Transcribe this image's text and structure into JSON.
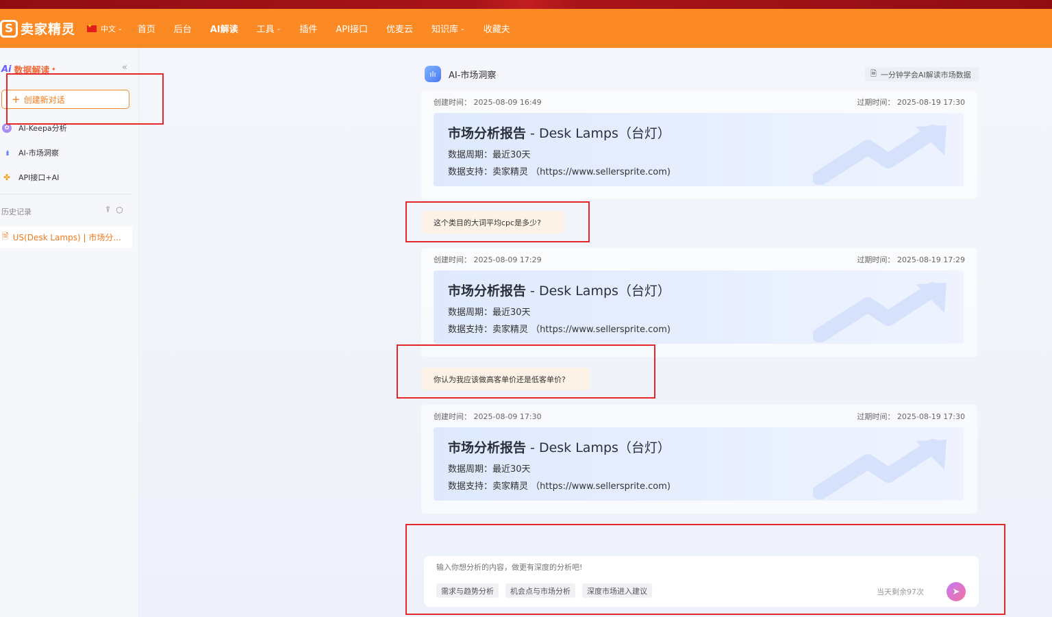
{
  "navbar": {
    "logo_text": "卖家精灵",
    "language": "中文",
    "items": [
      {
        "label": "首页",
        "dropdown": false,
        "bold": false
      },
      {
        "label": "后台",
        "dropdown": false,
        "bold": false
      },
      {
        "label": "AI解读",
        "dropdown": false,
        "bold": true
      },
      {
        "label": "工具",
        "dropdown": true,
        "bold": false
      },
      {
        "label": "插件",
        "dropdown": false,
        "bold": false
      },
      {
        "label": "API接口",
        "dropdown": false,
        "bold": false
      },
      {
        "label": "优麦云",
        "dropdown": false,
        "bold": false
      },
      {
        "label": "知识库",
        "dropdown": true,
        "bold": false
      },
      {
        "label": "收藏夫",
        "dropdown": false,
        "bold": false
      }
    ]
  },
  "sidebar": {
    "title_badge": "Ai",
    "title": "数据解读",
    "new_chat_label": "创建新对话",
    "menu": [
      {
        "label": "AI-Keepa分析",
        "icon": "keepa-icon"
      },
      {
        "label": "AI-市场洞察",
        "icon": "bar-chart-icon"
      },
      {
        "label": "API接口+AI",
        "icon": "api-icon"
      }
    ],
    "history_label": "历史记录",
    "history_items": [
      {
        "label": "US(Desk Lamps) | 市场分..."
      }
    ]
  },
  "chat": {
    "title": "AI-市场洞察",
    "guide_label": "一分钟学会AI解读市场数据",
    "cards": [
      {
        "created_label": "创建时间：",
        "created": "2025-08-09 16:49",
        "expire_label": "过期时间：",
        "expire": "2025-08-19 17:30",
        "title": "市场分析报告",
        "title_en": " - Desk Lamps（台灯）",
        "period": "数据周期：最近30天",
        "source": "数据支持：卖家精灵 （https://www.sellersprite.com)"
      },
      {
        "created_label": "创建时间：",
        "created": "2025-08-09 17:29",
        "expire_label": "过期时间：",
        "expire": "2025-08-19 17:29",
        "title": "市场分析报告",
        "title_en": " - Desk Lamps（台灯）",
        "period": "数据周期：最近30天",
        "source": "数据支持：卖家精灵 （https://www.sellersprite.com)"
      },
      {
        "created_label": "创建时间：",
        "created": "2025-08-09 17:30",
        "expire_label": "过期时间：",
        "expire": "2025-08-19 17:30",
        "title": "市场分析报告",
        "title_en": " - Desk Lamps（台灯）",
        "period": "数据周期：最近30天",
        "source": "数据支持：卖家精灵 （https://www.sellersprite.com)"
      }
    ],
    "questions": [
      "这个类目的大词平均cpc是多少?",
      "你认为我应该做高客单价还是低客单价?"
    ]
  },
  "composer": {
    "placeholder": "输入你想分析的内容，做更有深度的分析吧!",
    "chips": [
      "需求与趋势分析",
      "机会点与市场分析",
      "深度市场进入建议"
    ],
    "quota": "当天剩余97次"
  },
  "colors": {
    "brand_orange": "#fb8a24",
    "annotation_red": "#e3262a",
    "accent_text": "#f07a1a"
  }
}
